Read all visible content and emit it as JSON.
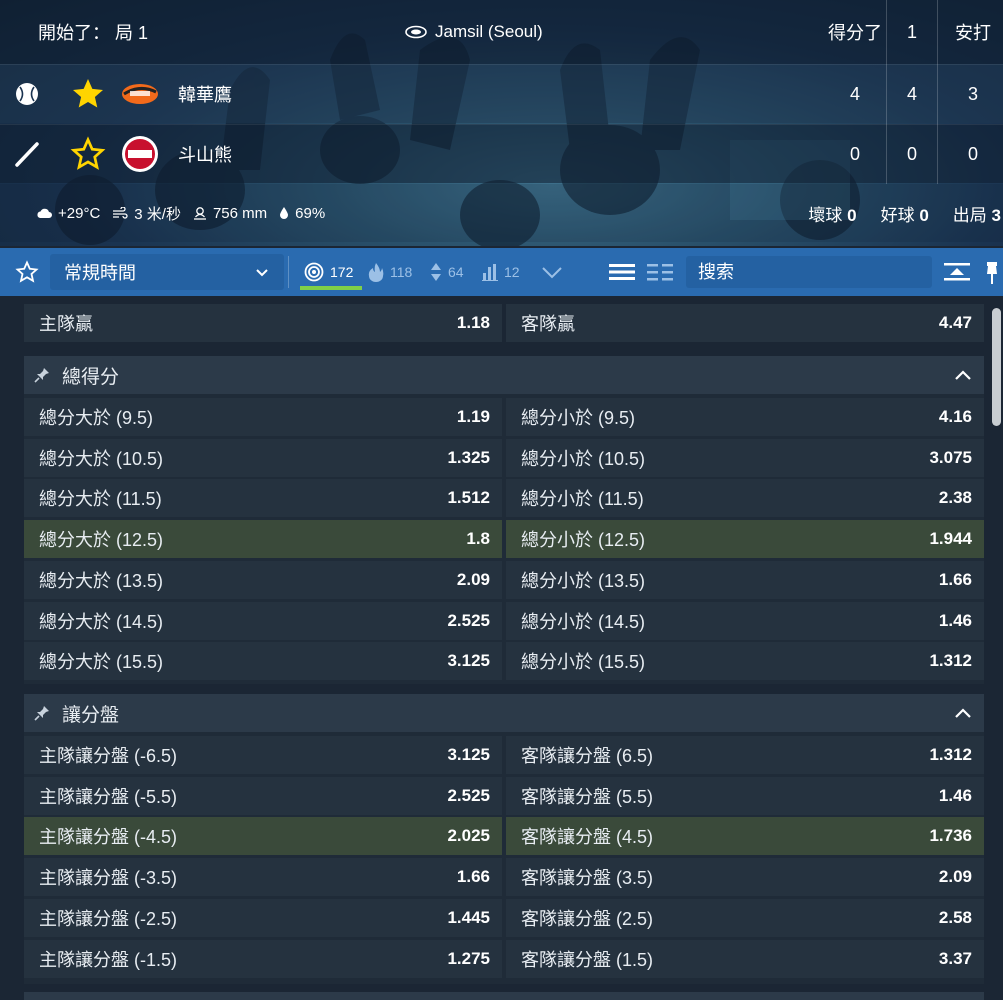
{
  "match": {
    "status": "開始了： 局 1",
    "venue": "Jamsil (Seoul)",
    "columns": {
      "runs": "得分了",
      "inning": "1",
      "hits": "安打"
    },
    "teams": [
      {
        "name": "韓華鷹",
        "role": "batting",
        "favorited": true,
        "runs": "4",
        "inning": "4",
        "hits": "3",
        "logo_color": "#f26a1b"
      },
      {
        "name": "斗山熊",
        "role": "pitching",
        "favorited": false,
        "runs": "0",
        "inning": "0",
        "hits": "0",
        "logo_color": "#c8102e"
      }
    ],
    "weather": {
      "temperature": "+29°C",
      "wind": "3 米/秒",
      "pressure": "756 mm",
      "humidity": "69%"
    },
    "counts": {
      "balls_label": "壞球",
      "balls": "0",
      "strikes_label": "好球",
      "strikes": "0",
      "outs_label": "出局",
      "outs": "3"
    }
  },
  "filterbar": {
    "period": "常規時間",
    "tabs": [
      {
        "icon": "target-icon",
        "count": "172",
        "active": true
      },
      {
        "icon": "fire-icon",
        "count": "118",
        "active": false
      },
      {
        "icon": "updown-icon",
        "count": "64",
        "active": false
      },
      {
        "icon": "bars-icon",
        "count": "12",
        "active": false
      }
    ],
    "search_placeholder": "搜索"
  },
  "markets": {
    "moneyline": {
      "home_label": "主隊贏",
      "home_odds": "1.18",
      "away_label": "客隊贏",
      "away_odds": "4.47"
    },
    "groups": [
      {
        "title": "總得分",
        "rows": [
          {
            "left": "總分大於 (9.5)",
            "left_odds": "1.19",
            "right": "總分小於 (9.5)",
            "right_odds": "4.16",
            "highlight": false
          },
          {
            "left": "總分大於 (10.5)",
            "left_odds": "1.325",
            "right": "總分小於 (10.5)",
            "right_odds": "3.075",
            "highlight": false
          },
          {
            "left": "總分大於 (11.5)",
            "left_odds": "1.512",
            "right": "總分小於 (11.5)",
            "right_odds": "2.38",
            "highlight": false
          },
          {
            "left": "總分大於 (12.5)",
            "left_odds": "1.8",
            "right": "總分小於 (12.5)",
            "right_odds": "1.944",
            "highlight": true
          },
          {
            "left": "總分大於 (13.5)",
            "left_odds": "2.09",
            "right": "總分小於 (13.5)",
            "right_odds": "1.66",
            "highlight": false
          },
          {
            "left": "總分大於 (14.5)",
            "left_odds": "2.525",
            "right": "總分小於 (14.5)",
            "right_odds": "1.46",
            "highlight": false
          },
          {
            "left": "總分大於 (15.5)",
            "left_odds": "3.125",
            "right": "總分小於 (15.5)",
            "right_odds": "1.312",
            "highlight": false
          }
        ]
      },
      {
        "title": "讓分盤",
        "rows": [
          {
            "left": "主隊讓分盤 (-6.5)",
            "left_odds": "3.125",
            "right": "客隊讓分盤 (6.5)",
            "right_odds": "1.312",
            "highlight": false
          },
          {
            "left": "主隊讓分盤 (-5.5)",
            "left_odds": "2.525",
            "right": "客隊讓分盤 (5.5)",
            "right_odds": "1.46",
            "highlight": false
          },
          {
            "left": "主隊讓分盤 (-4.5)",
            "left_odds": "2.025",
            "right": "客隊讓分盤 (4.5)",
            "right_odds": "1.736",
            "highlight": true
          },
          {
            "left": "主隊讓分盤 (-3.5)",
            "left_odds": "1.66",
            "right": "客隊讓分盤 (3.5)",
            "right_odds": "2.09",
            "highlight": false
          },
          {
            "left": "主隊讓分盤 (-2.5)",
            "left_odds": "1.445",
            "right": "客隊讓分盤 (2.5)",
            "right_odds": "2.58",
            "highlight": false
          },
          {
            "left": "主隊讓分盤 (-1.5)",
            "left_odds": "1.275",
            "right": "客隊讓分盤 (1.5)",
            "right_odds": "3.37",
            "highlight": false
          }
        ]
      }
    ]
  }
}
